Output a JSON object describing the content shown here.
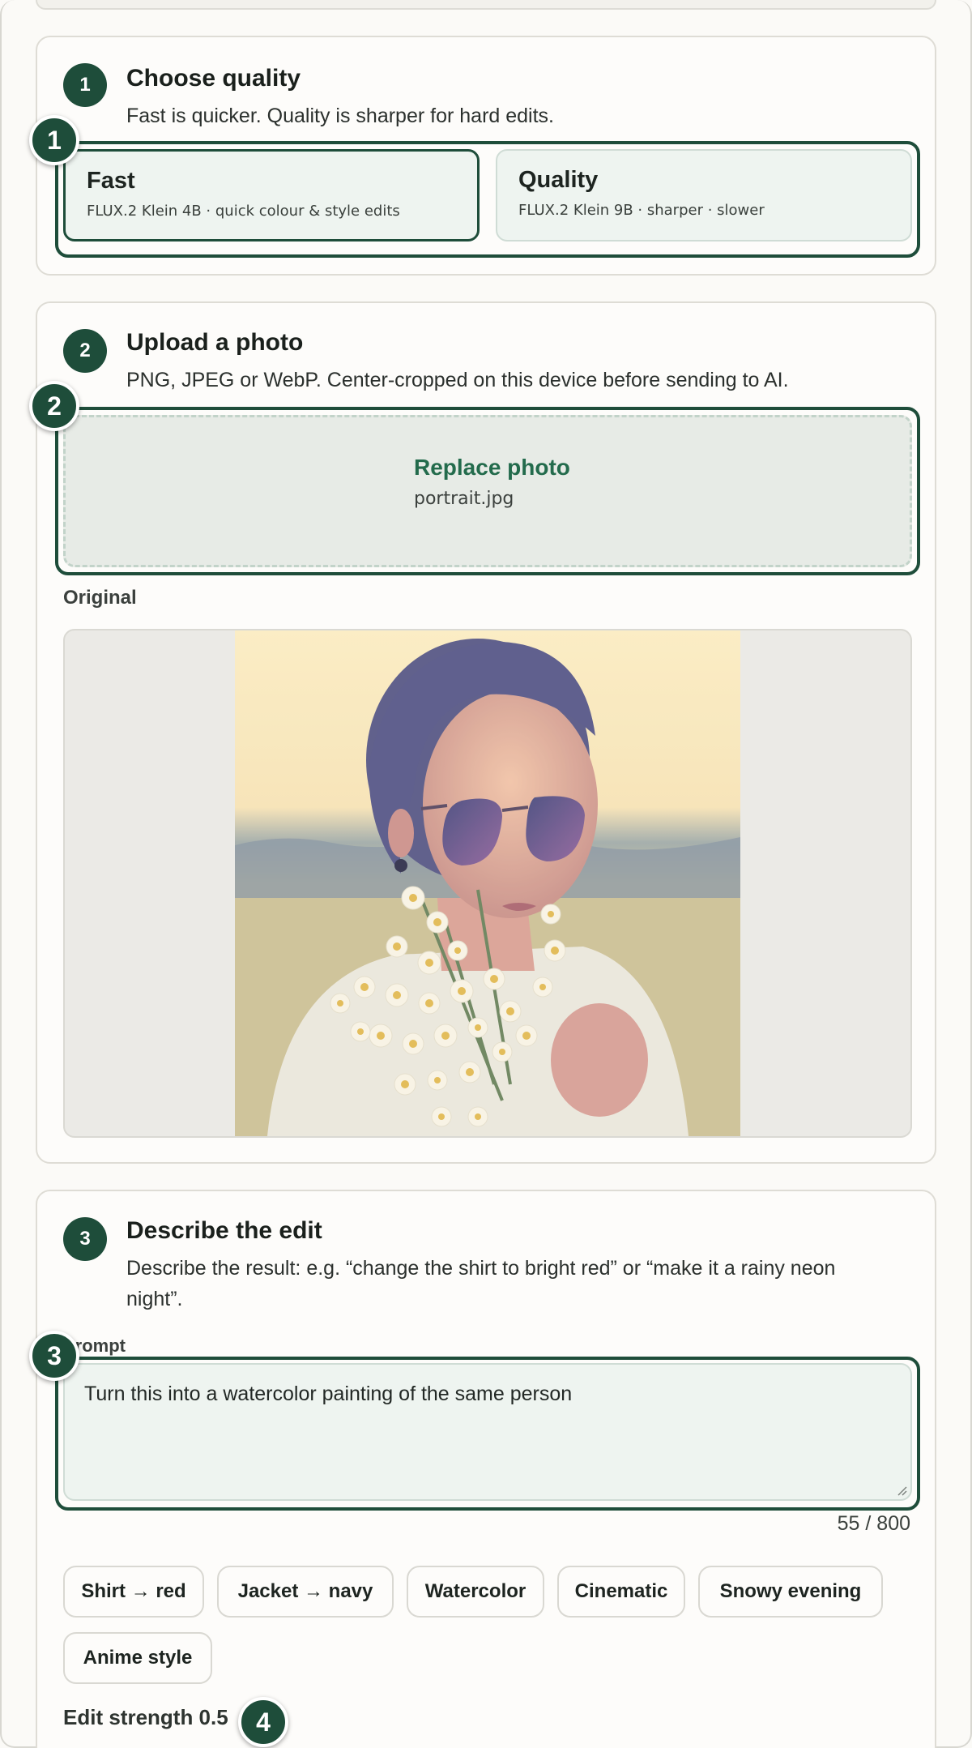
{
  "quality": {
    "step": "1",
    "title": "Choose quality",
    "subtitle": "Fast is quicker. Quality is sharper for hard edits.",
    "marker": "1",
    "options": [
      {
        "title": "Fast",
        "desc": "FLUX.2 Klein 4B · quick colour & style edits",
        "selected": true
      },
      {
        "title": "Quality",
        "desc": "FLUX.2 Klein 9B · sharper · slower",
        "selected": false
      }
    ]
  },
  "upload": {
    "step": "2",
    "title": "Upload a photo",
    "subtitle": "PNG, JPEG or WebP. Center-cropped on this device before sending to AI.",
    "marker": "2",
    "replace_label": "Replace photo",
    "file_name": "portrait.jpg",
    "original_label": "Original"
  },
  "edit": {
    "step": "3",
    "title": "Describe the edit",
    "subtitle": "Describe the result: e.g. “change the shirt to bright red” or “make it a rainy neon night”.",
    "marker": "3",
    "prompt_label": "Prompt",
    "prompt_value": "Turn this into a watercolor painting of the same person",
    "counter": "55 / 800",
    "chips": [
      "Shirt → red",
      "Jacket → navy",
      "Watercolor",
      "Cinematic",
      "Snowy evening",
      "Anime style"
    ],
    "strength_label": "Edit strength 0.5",
    "strength_marker": "4"
  },
  "colors": {
    "accent": "#1e4d3a",
    "link": "#236b4c",
    "option_bg": "#eef4f0",
    "page_bg": "#fbfaf7"
  }
}
